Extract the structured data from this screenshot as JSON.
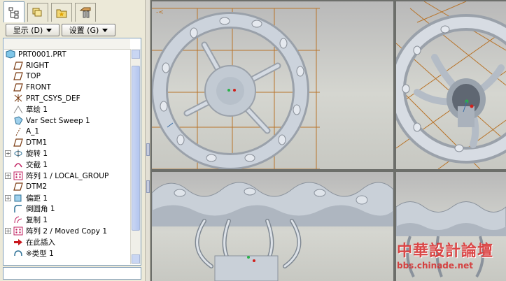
{
  "panel_tabs": [
    {
      "name": "model-tree-tab",
      "icon": "model-tree-icon",
      "active": true
    },
    {
      "name": "folder-browser-tab",
      "icon": "folder-icon"
    },
    {
      "name": "favorites-tab",
      "icon": "favorites-icon"
    },
    {
      "name": "connections-tab",
      "icon": "connections-icon"
    }
  ],
  "toolbar": {
    "show_label": "显示 (D)",
    "settings_label": "设置 (G)"
  },
  "tree": {
    "root": "PRT0001.PRT",
    "items": [
      {
        "label": "RIGHT",
        "icon": "datum-plane-icon",
        "expandable": false
      },
      {
        "label": "TOP",
        "icon": "datum-plane-icon",
        "expandable": false
      },
      {
        "label": "FRONT",
        "icon": "datum-plane-icon",
        "expandable": false
      },
      {
        "label": "PRT_CSYS_DEF",
        "icon": "coordinate-system-icon",
        "expandable": false
      },
      {
        "label": "草绘 1",
        "icon": "sketch-icon",
        "expandable": false
      },
      {
        "label": "Var Sect Sweep 1",
        "icon": "sweep-icon",
        "expandable": false
      },
      {
        "label": "A_1",
        "icon": "datum-axis-icon",
        "expandable": false
      },
      {
        "label": "DTM1",
        "icon": "datum-plane-icon",
        "expandable": false
      },
      {
        "label": "旋转 1",
        "icon": "revolve-icon",
        "expandable": true
      },
      {
        "label": "交截 1",
        "icon": "intersect-icon",
        "expandable": false
      },
      {
        "label": "阵列 1 / LOCAL_GROUP",
        "icon": "pattern-icon",
        "expandable": true
      },
      {
        "label": "DTM2",
        "icon": "datum-plane-icon",
        "expandable": false
      },
      {
        "label": "偏距 1",
        "icon": "offset-icon",
        "expandable": true
      },
      {
        "label": "倒圆角 1",
        "icon": "round-icon",
        "expandable": false
      },
      {
        "label": "复制 1",
        "icon": "copy-icon",
        "expandable": false
      },
      {
        "label": "阵列 2 / Moved Copy 1",
        "icon": "pattern-icon",
        "expandable": true
      },
      {
        "label": "在此插入",
        "icon": "insert-here-arrow-icon",
        "expandable": false
      },
      {
        "label": "※类型 1",
        "icon": "feature-type-icon",
        "expandable": false
      }
    ]
  },
  "viewports": [
    {
      "name": "viewport-front",
      "view": "front view of handwheel"
    },
    {
      "name": "viewport-iso",
      "view": "isometric view of handwheel"
    },
    {
      "name": "viewport-side",
      "view": "side view of handwheel"
    },
    {
      "name": "viewport-side-small",
      "view": "side view of handwheel"
    }
  ],
  "watermark": {
    "title": "中華設計論壇",
    "url": "bbs.chinade.net"
  },
  "colors": {
    "part_gray": "#c4ccd6",
    "datum_orange": "#b8742a",
    "selection_blue": "#3a6ea5"
  }
}
